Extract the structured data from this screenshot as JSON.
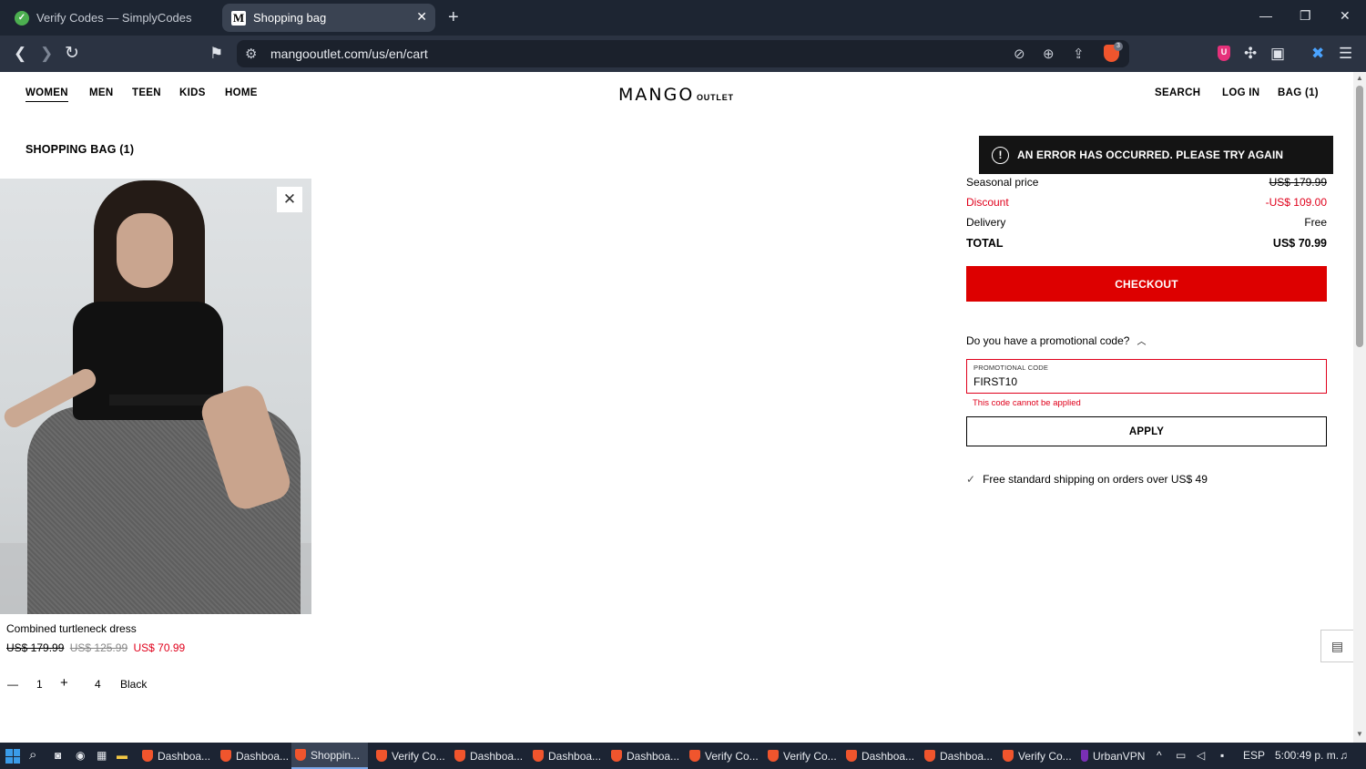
{
  "browser": {
    "tabs": [
      {
        "title": "Verify Codes — SimplyCodes",
        "icon": "simplycodes-icon"
      },
      {
        "title": "Shopping bag",
        "icon": "mango-m-icon"
      }
    ],
    "url": "mangooutlet.com/us/en/cart",
    "extension_badge": "3"
  },
  "header": {
    "nav": [
      "WOMEN",
      "MEN",
      "TEEN",
      "KIDS",
      "HOME"
    ],
    "logo": "MANGO",
    "logo_sub": "OUTLET",
    "right": [
      "SEARCH",
      "LOG IN",
      "BAG (1)"
    ]
  },
  "bag": {
    "title": "SHOPPING BAG (1)",
    "item": {
      "name": "Combined turtleneck dress",
      "price_original": "US$ 179.99",
      "price_previous": "US$ 125.99",
      "price_current": "US$ 70.99",
      "quantity": "1",
      "size": "4",
      "color": "Black"
    }
  },
  "error": {
    "message": "AN ERROR HAS OCCURRED. PLEASE TRY AGAIN",
    "icon_text": "!"
  },
  "summary": {
    "seasonal_label": "Seasonal price",
    "seasonal_value": "US$ 179.99",
    "discount_label": "Discount",
    "discount_value": "-US$ 109.00",
    "delivery_label": "Delivery",
    "delivery_value": "Free",
    "total_label": "TOTAL",
    "total_value": "US$ 70.99",
    "checkout": "CHECKOUT"
  },
  "promo": {
    "question": "Do you have a promotional code?",
    "field_label": "PROMOTIONAL CODE",
    "value": "FIRST10",
    "error": "This code cannot be applied",
    "apply": "APPLY"
  },
  "shipping": {
    "text": "Free standard shipping on orders over US$ 49"
  },
  "taskbar": {
    "apps": [
      "Dashboa...",
      "Dashboa...",
      "Shoppin...",
      "Verify Co...",
      "Dashboa...",
      "Dashboa...",
      "Dashboa...",
      "Verify Co...",
      "Verify Co...",
      "Dashboa...",
      "Dashboa...",
      "Verify Co...",
      "UrbanVPN"
    ],
    "active_index": 2,
    "lang": "ESP",
    "time": "5:00:49 p. m."
  },
  "colors": {
    "accent_red": "#dd0000",
    "error_bg": "#141414",
    "chrome_bg": "#1d2532"
  }
}
